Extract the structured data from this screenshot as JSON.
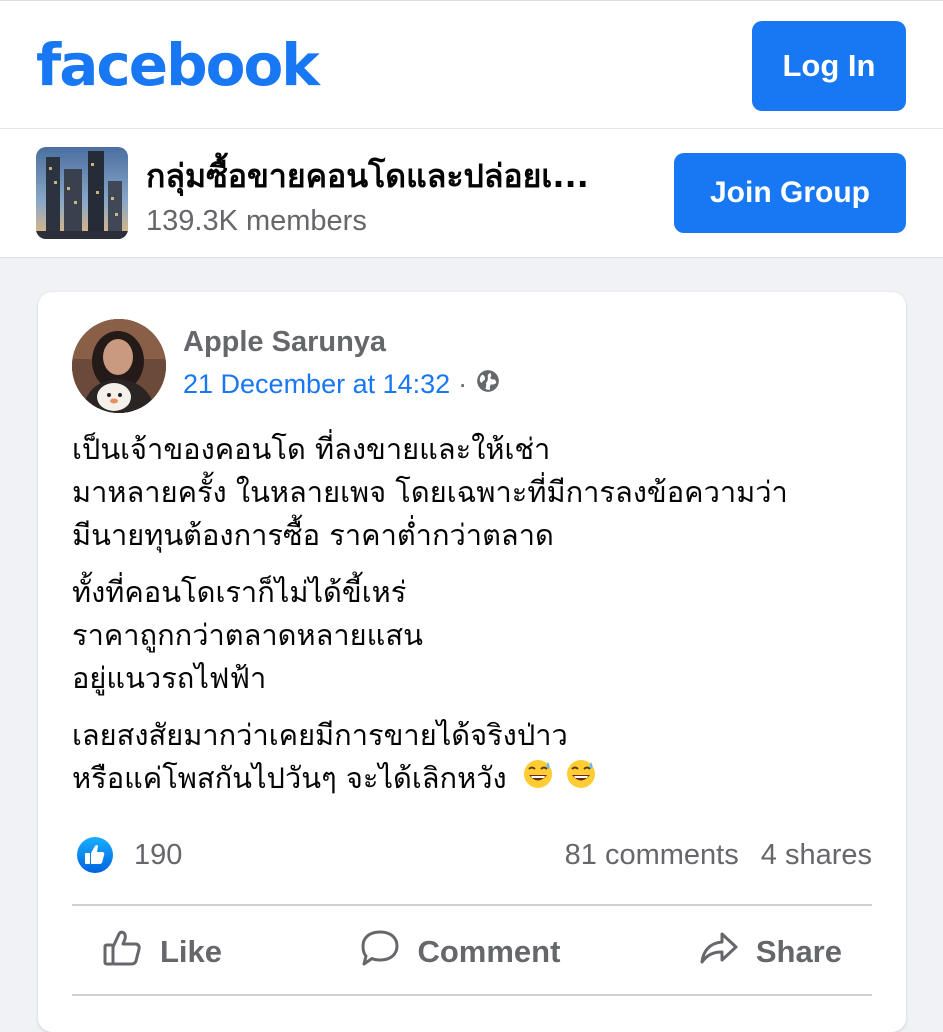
{
  "header": {
    "logo_text": "facebook",
    "login_label": "Log In",
    "brand_color": "#1877f2"
  },
  "group": {
    "name": "กลุ่มซื้อขายคอนโดและปล่อยเ...",
    "members": "139.3K members",
    "join_label": "Join Group"
  },
  "post": {
    "author": "Apple Sarunya",
    "timestamp": "21 December at 14:32",
    "separator": "·",
    "privacy_icon": "globe-icon",
    "paragraphs": [
      [
        "เป็นเจ้าของคอนโด ที่ลงขายและให้เช่า",
        "มาหลายครั้ง ในหลายเพจ โดยเฉพาะที่มีการลงข้อความว่า",
        "มีนายทุนต้องการซื้อ ราคาต่ำกว่าตลาด"
      ],
      [
        "ทั้งที่คอนโดเราก็ไม่ได้ขี้เหร่",
        "ราคาถูกกว่าตลาดหลายแสน",
        "อยู่แนวรถไฟฟ้า"
      ],
      [
        "เลยสงสัยมากว่าเคยมีการขายได้จริงป่าว",
        "หรือแค่โพสกันไปวันๆ จะได้เลิกหวัง"
      ]
    ],
    "emoji": [
      "grinning-sweat-emoji",
      "grinning-sweat-emoji"
    ],
    "reactions": {
      "icon": "like-icon",
      "count": "190"
    },
    "comments": "81 comments",
    "shares": "4 shares",
    "actions": {
      "like": "Like",
      "comment": "Comment",
      "share": "Share"
    }
  }
}
